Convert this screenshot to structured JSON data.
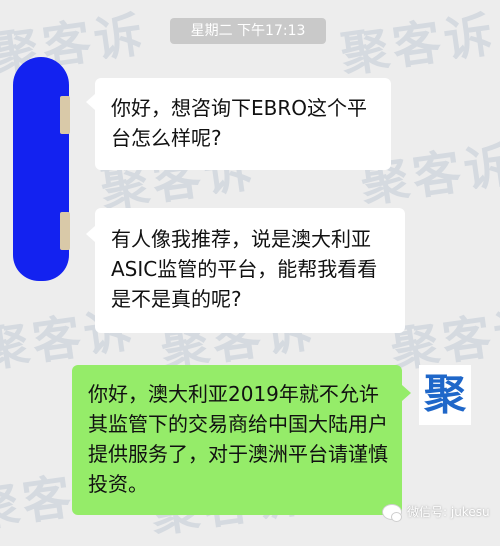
{
  "chat": {
    "timestamp": "星期二 下午17:13",
    "messages": [
      {
        "side": "in",
        "text": "你好，想咨询下EBRO这个平台怎么样呢?"
      },
      {
        "side": "in",
        "text": "有人像我推荐，说是澳大利亚ASIC监管的平台，能帮我看看是不是真的呢?"
      },
      {
        "side": "out",
        "text": "你好，澳大利亚2019年就不允许其监管下的交易商给中国大陆用户提供服务了，对于澳洲平台请谨慎投资。"
      }
    ]
  },
  "watermark": {
    "text": "聚客诉"
  },
  "logo": {
    "char": "聚",
    "color": "#1f67c9"
  },
  "footer": {
    "wechat_id": "微信号: jukesu"
  },
  "colors": {
    "background": "#ededed",
    "incoming_bubble": "#ffffff",
    "outgoing_bubble": "#95ec69",
    "redaction": "#1322f0"
  }
}
